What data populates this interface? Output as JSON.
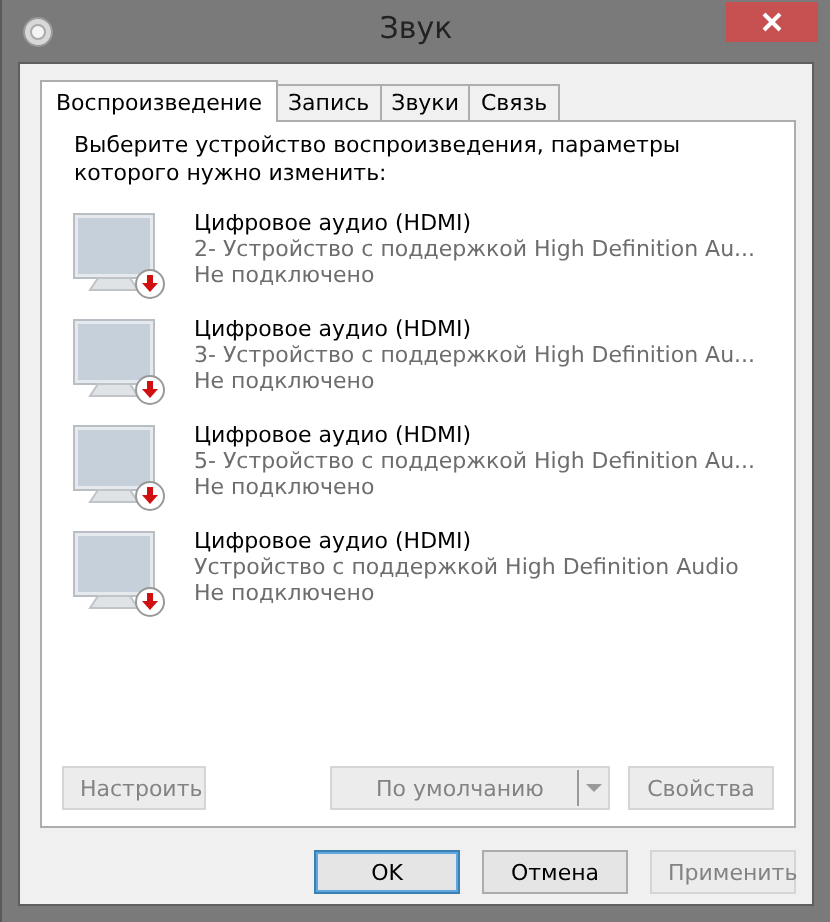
{
  "window": {
    "title": "Звук"
  },
  "tabs": [
    {
      "label": "Воспроизведение",
      "selected": true
    },
    {
      "label": "Запись",
      "selected": false
    },
    {
      "label": "Звуки",
      "selected": false
    },
    {
      "label": "Связь",
      "selected": false
    }
  ],
  "instruction": "Выберите устройство воспроизведения, параметры которого нужно изменить:",
  "devices": [
    {
      "name": "Цифровое аудио (HDMI)",
      "description": "2- Устройство с поддержкой High Definition Au...",
      "status": "Не подключено",
      "disconnected": true
    },
    {
      "name": "Цифровое аудио (HDMI)",
      "description": "3- Устройство с поддержкой High Definition Au...",
      "status": "Не подключено",
      "disconnected": true
    },
    {
      "name": "Цифровое аудио (HDMI)",
      "description": "5- Устройство с поддержкой High Definition Au...",
      "status": "Не подключено",
      "disconnected": true
    },
    {
      "name": "Цифровое аудио (HDMI)",
      "description": "Устройство с поддержкой High Definition Audio",
      "status": "Не подключено",
      "disconnected": true
    }
  ],
  "panel_buttons": [
    {
      "label": "Настроить",
      "kind": "plain",
      "disabled": true
    },
    {
      "label": "По умолчанию",
      "kind": "split",
      "disabled": true
    },
    {
      "label": "Свойства",
      "kind": "plain",
      "disabled": true
    }
  ],
  "dialog_buttons": [
    {
      "label": "OK",
      "disabled": false,
      "default": true
    },
    {
      "label": "Отмена",
      "disabled": false,
      "default": false
    },
    {
      "label": "Применить",
      "disabled": true,
      "default": false
    }
  ]
}
